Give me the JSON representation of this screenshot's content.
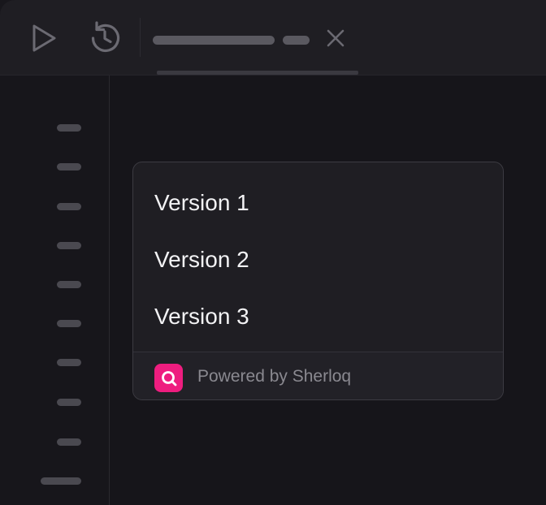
{
  "toolbar": {
    "icons": [
      "play-icon",
      "history-icon",
      "close-icon"
    ]
  },
  "popup": {
    "items": [
      {
        "label": "Version 1"
      },
      {
        "label": "Version 2"
      },
      {
        "label": "Version 3"
      }
    ],
    "footer": {
      "logo_icon": "search-icon",
      "text": "Powered by Sherloq",
      "brand_color": "#ee1d7f"
    }
  }
}
